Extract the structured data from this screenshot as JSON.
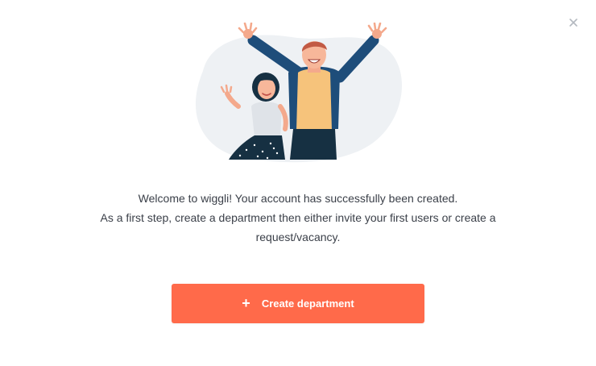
{
  "dialog": {
    "close_icon": "close-icon",
    "message_line1": "Welcome to wiggli! Your account has successfully been created.",
    "message_line2": "As a first step, create a department then either invite your first users or create a request/vacancy.",
    "button_icon": "+",
    "button_label": "Create department"
  },
  "colors": {
    "accent": "#ff6a4a",
    "text": "#3a3f48",
    "blob": "#eef1f4"
  }
}
